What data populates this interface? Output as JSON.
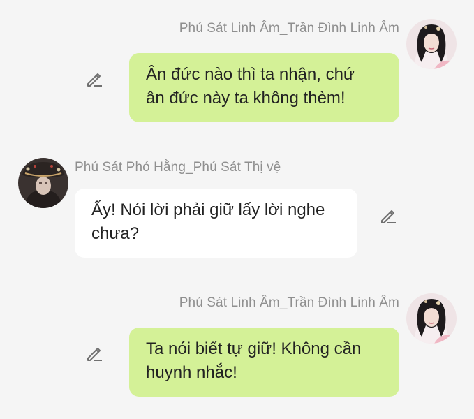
{
  "colors": {
    "background": "#f5f5f5",
    "bubble_self": "#d4f197",
    "bubble_other": "#ffffff",
    "sender_text": "#8f8f8f",
    "message_text": "#222222"
  },
  "messages": [
    {
      "sender": "Phú Sát Linh Âm_Trần Đình Linh Âm",
      "text": "Ân đức nào thì ta nhận, chứ\nân đức này ta không thèm!",
      "side": "right",
      "avatar_icon": "female-avatar",
      "edit_icon": "pencil-icon"
    },
    {
      "sender": "Phú Sát Phó Hằng_Phú Sát Thị vệ",
      "text": "Ấy! Nói lời phải giữ lấy lời nghe\nchưa?",
      "side": "left",
      "avatar_icon": "male-avatar",
      "edit_icon": "pencil-icon"
    },
    {
      "sender": "Phú Sát Linh Âm_Trần Đình Linh Âm",
      "text": "Ta nói biết tự giữ! Không cần\nhuynh nhắc!",
      "side": "right",
      "avatar_icon": "female-avatar",
      "edit_icon": "pencil-icon"
    }
  ]
}
